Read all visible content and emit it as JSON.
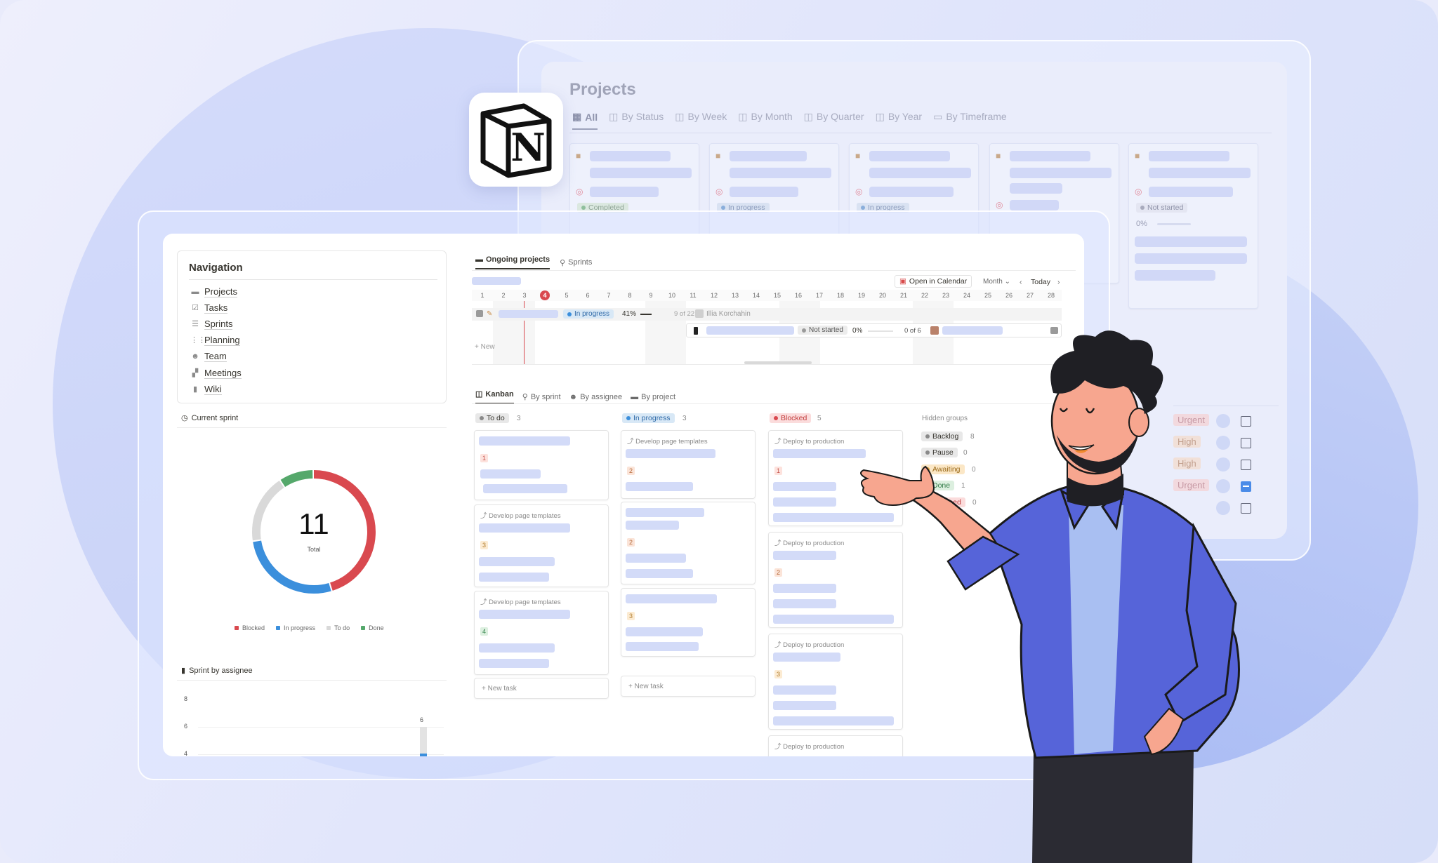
{
  "projects_window": {
    "title": "Projects",
    "tabs": [
      {
        "label": "All",
        "icon": "grid-icon"
      },
      {
        "label": "By Status",
        "icon": "board-icon"
      },
      {
        "label": "By Week",
        "icon": "board-icon"
      },
      {
        "label": "By Month",
        "icon": "board-icon"
      },
      {
        "label": "By Quarter",
        "icon": "board-icon"
      },
      {
        "label": "By Year",
        "icon": "board-icon"
      },
      {
        "label": "By Timeframe",
        "icon": "timeline-icon"
      }
    ],
    "card_statuses": [
      "Completed",
      "In progress",
      "In progress",
      "",
      "Not started"
    ],
    "progress": "0%",
    "priorities": [
      "Urgent",
      "High",
      "High",
      "Urgent",
      ""
    ],
    "checked": [
      false,
      false,
      false,
      true,
      false
    ]
  },
  "logo": {
    "letter": "N"
  },
  "navigation": {
    "title": "Navigation",
    "items": [
      {
        "label": "Projects",
        "icon": "folder-icon"
      },
      {
        "label": "Tasks",
        "icon": "checkbox-icon"
      },
      {
        "label": "Sprints",
        "icon": "stack-icon"
      },
      {
        "label": "Planning",
        "icon": "planning-icon"
      },
      {
        "label": "Team",
        "icon": "team-icon"
      },
      {
        "label": "Meetings",
        "icon": "meetings-icon"
      },
      {
        "label": "Wiki",
        "icon": "book-icon"
      }
    ]
  },
  "current_sprint": {
    "title": "Current sprint",
    "total": "11",
    "total_label": "Total",
    "legend": [
      "Blocked",
      "In progress",
      "To do",
      "Done"
    ],
    "colors": {
      "blocked": "#d9494f",
      "in_progress": "#3b8fdc",
      "todo": "#d9d9d9",
      "done": "#55a86b"
    },
    "segments": {
      "blocked": 5,
      "in_progress": 3,
      "todo": 2,
      "done": 1
    }
  },
  "sprint_by_assignee": {
    "title": "Sprint by assignee",
    "y_ticks": [
      "8",
      "6",
      "4"
    ],
    "bar_label": "6",
    "bar_value": 6
  },
  "timeline": {
    "tabs": [
      "Ongoing projects",
      "Sprints"
    ],
    "open_calendar": "Open in Calendar",
    "period": "Month",
    "today": "Today",
    "days": [
      "1",
      "2",
      "3",
      "4",
      "5",
      "6",
      "7",
      "8",
      "9",
      "10",
      "11",
      "12",
      "13",
      "14",
      "15",
      "16",
      "17",
      "18",
      "19",
      "20",
      "21",
      "22",
      "23",
      "24",
      "25",
      "26",
      "27",
      "28"
    ],
    "today_day": "4",
    "row1": {
      "status": "In progress",
      "percent": "41%",
      "count": "9 of 22",
      "owner": "Illia Korchahin"
    },
    "row2": {
      "status": "Not started",
      "percent": "0%",
      "count": "0 of 6"
    },
    "new_label": "New"
  },
  "kanban": {
    "tabs": [
      "Kanban",
      "By sprint",
      "By assignee",
      "By project"
    ],
    "columns": [
      {
        "name": "To do",
        "count": "3",
        "new_label": "New task"
      },
      {
        "name": "In progress",
        "count": "3",
        "new_label": "New task"
      },
      {
        "name": "Blocked",
        "count": "5"
      }
    ],
    "parents": {
      "develop": "Develop page templates",
      "deploy": "Deploy to production"
    },
    "numbers": {
      "todo": [
        "1",
        "3",
        "4"
      ],
      "inprogress": [
        "2",
        "2",
        "3"
      ],
      "blocked": [
        "1",
        "2",
        "3"
      ]
    },
    "hidden_groups": {
      "title": "Hidden groups",
      "items": [
        {
          "name": "Backlog",
          "count": "8"
        },
        {
          "name": "Pause",
          "count": "0"
        },
        {
          "name": "Awaiting",
          "count": "0"
        },
        {
          "name": "Done",
          "count": "1"
        },
        {
          "name": "Declined",
          "count": "0"
        }
      ]
    }
  }
}
